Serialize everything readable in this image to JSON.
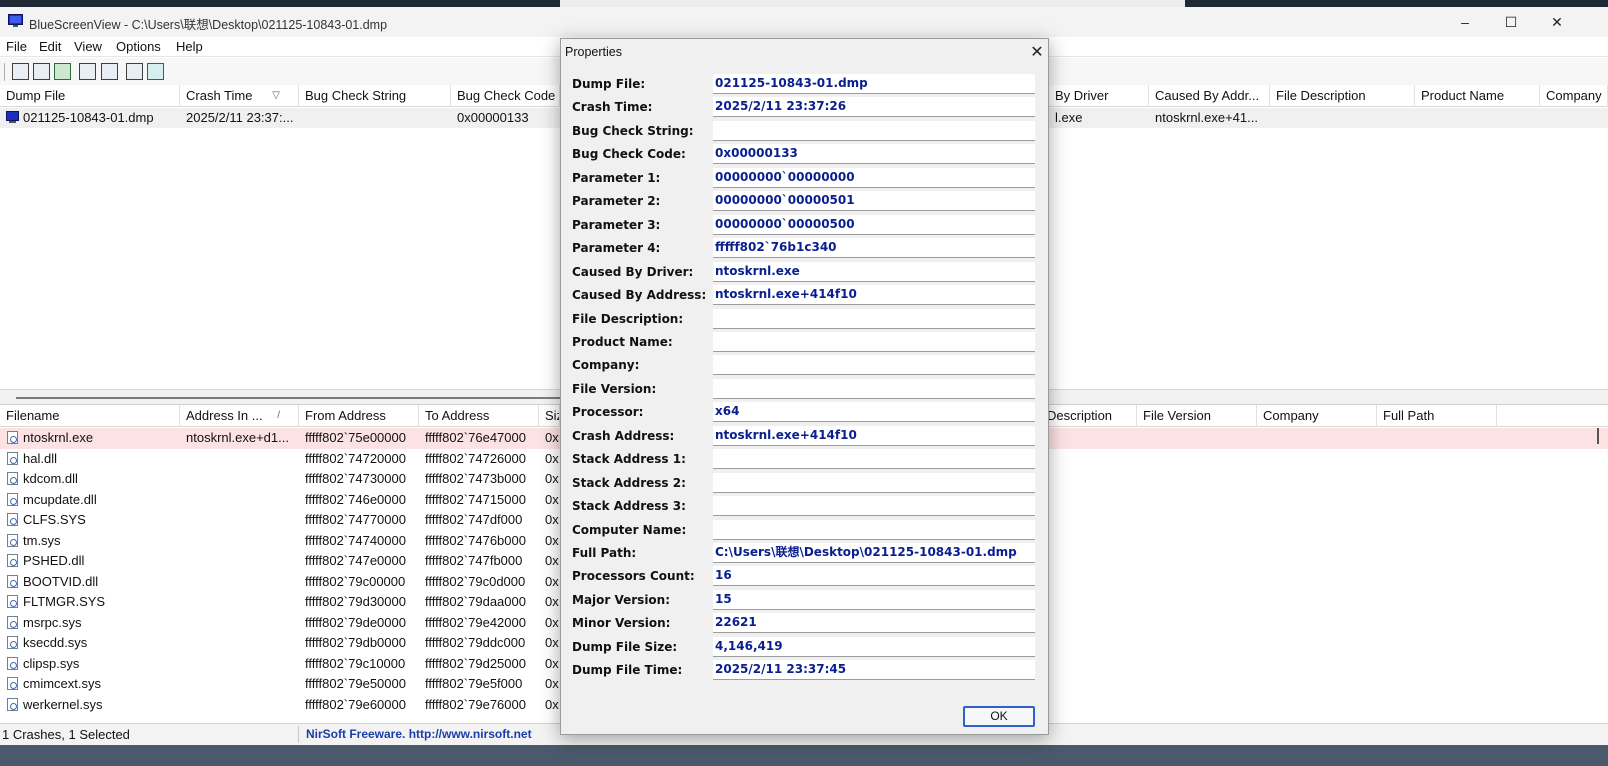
{
  "app": {
    "title": "BlueScreenView  -  C:\\Users\\联想\\Desktop\\021125-10843-01.dmp",
    "window_controls": [
      "–",
      "☐",
      "✕"
    ]
  },
  "menu": [
    "File",
    "Edit",
    "View",
    "Options",
    "Help"
  ],
  "toolbar": {
    "icons": [
      "properties-icon",
      "save-icon",
      "refresh-icon",
      "copy-icon",
      "html-report-icon",
      "find-icon",
      "exit-icon"
    ]
  },
  "upper_grid": {
    "columns": [
      "Dump File",
      "Crash Time",
      "Bug Check String",
      "Bug Check Code",
      "By Driver",
      "Caused By Addr...",
      "File Description",
      "Product Name",
      "Company"
    ],
    "sort_indicator": "▽",
    "row": {
      "dump_file": "021125-10843-01.dmp",
      "crash_time": "2025/2/11 23:37:...",
      "bug_check_string": "",
      "bug_check_code": "0x00000133",
      "by_driver": "l.exe",
      "caused_by_address": "ntoskrnl.exe+41..."
    }
  },
  "lower_grid": {
    "columns": [
      "Filename",
      "Address In ...",
      "From Address",
      "To Address",
      "Siz",
      "Description",
      "File Version",
      "Company",
      "Full Path"
    ],
    "sort_indicator": "/",
    "rows": [
      {
        "filename": "ntoskrnl.exe",
        "address_in": "ntoskrnl.exe+d1...",
        "from": "fffff802`75e00000",
        "to": "fffff802`76e47000",
        "size": "0x",
        "highlight": true
      },
      {
        "filename": "hal.dll",
        "address_in": "",
        "from": "fffff802`74720000",
        "to": "fffff802`74726000",
        "size": "0x"
      },
      {
        "filename": "kdcom.dll",
        "address_in": "",
        "from": "fffff802`74730000",
        "to": "fffff802`7473b000",
        "size": "0x"
      },
      {
        "filename": "mcupdate.dll",
        "address_in": "",
        "from": "fffff802`746e0000",
        "to": "fffff802`74715000",
        "size": "0x"
      },
      {
        "filename": "CLFS.SYS",
        "address_in": "",
        "from": "fffff802`74770000",
        "to": "fffff802`747df000",
        "size": "0x"
      },
      {
        "filename": "tm.sys",
        "address_in": "",
        "from": "fffff802`74740000",
        "to": "fffff802`7476b000",
        "size": "0x"
      },
      {
        "filename": "PSHED.dll",
        "address_in": "",
        "from": "fffff802`747e0000",
        "to": "fffff802`747fb000",
        "size": "0x"
      },
      {
        "filename": "BOOTVID.dll",
        "address_in": "",
        "from": "fffff802`79c00000",
        "to": "fffff802`79c0d000",
        "size": "0x"
      },
      {
        "filename": "FLTMGR.SYS",
        "address_in": "",
        "from": "fffff802`79d30000",
        "to": "fffff802`79daa000",
        "size": "0x"
      },
      {
        "filename": "msrpc.sys",
        "address_in": "",
        "from": "fffff802`79de0000",
        "to": "fffff802`79e42000",
        "size": "0x"
      },
      {
        "filename": "ksecdd.sys",
        "address_in": "",
        "from": "fffff802`79db0000",
        "to": "fffff802`79ddc000",
        "size": "0x"
      },
      {
        "filename": "clipsp.sys",
        "address_in": "",
        "from": "fffff802`79c10000",
        "to": "fffff802`79d25000",
        "size": "0x"
      },
      {
        "filename": "cmimcext.sys",
        "address_in": "",
        "from": "fffff802`79e50000",
        "to": "fffff802`79e5f000",
        "size": "0x"
      },
      {
        "filename": "werkernel.sys",
        "address_in": "",
        "from": "fffff802`79e60000",
        "to": "fffff802`79e76000",
        "size": "0x"
      }
    ]
  },
  "statusbar": {
    "count": "1 Crashes, 1 Selected",
    "link": "NirSoft Freeware.  http://www.nirsoft.net"
  },
  "dialog": {
    "title": "Properties",
    "close": "✕",
    "ok_label": "OK",
    "properties": [
      {
        "label": "Dump File:",
        "value": "021125-10843-01.dmp"
      },
      {
        "label": "Crash Time:",
        "value": "2025/2/11 23:37:26"
      },
      {
        "label": "Bug Check String:",
        "value": ""
      },
      {
        "label": "Bug Check Code:",
        "value": "0x00000133"
      },
      {
        "label": "Parameter 1:",
        "value": "00000000`00000000"
      },
      {
        "label": "Parameter 2:",
        "value": "00000000`00000501"
      },
      {
        "label": "Parameter 3:",
        "value": "00000000`00000500"
      },
      {
        "label": "Parameter 4:",
        "value": "fffff802`76b1c340"
      },
      {
        "label": "Caused By Driver:",
        "value": "ntoskrnl.exe"
      },
      {
        "label": "Caused By Address:",
        "value": "ntoskrnl.exe+414f10"
      },
      {
        "label": "File Description:",
        "value": ""
      },
      {
        "label": "Product Name:",
        "value": ""
      },
      {
        "label": "Company:",
        "value": ""
      },
      {
        "label": "File Version:",
        "value": ""
      },
      {
        "label": "Processor:",
        "value": "x64"
      },
      {
        "label": "Crash Address:",
        "value": "ntoskrnl.exe+414f10"
      },
      {
        "label": "Stack Address 1:",
        "value": ""
      },
      {
        "label": "Stack Address 2:",
        "value": ""
      },
      {
        "label": "Stack Address 3:",
        "value": ""
      },
      {
        "label": "Computer Name:",
        "value": ""
      },
      {
        "label": "Full Path:",
        "value": "C:\\Users\\联想\\Desktop\\021125-10843-01.dmp"
      },
      {
        "label": "Processors Count:",
        "value": "16"
      },
      {
        "label": "Major Version:",
        "value": "15"
      },
      {
        "label": "Minor Version:",
        "value": "22621"
      },
      {
        "label": "Dump File Size:",
        "value": "4,146,419"
      },
      {
        "label": "Dump File Time:",
        "value": "2025/2/11 23:37:45"
      }
    ]
  }
}
